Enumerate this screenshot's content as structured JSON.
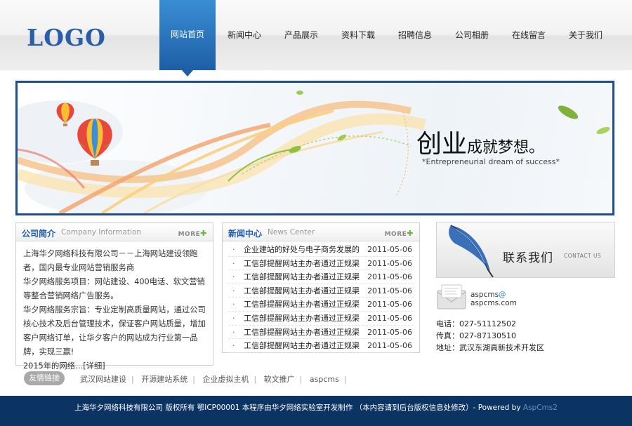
{
  "header": {
    "logo": "LOGO",
    "nav": [
      {
        "label": "网站首页",
        "active": true
      },
      {
        "label": "新闻中心"
      },
      {
        "label": "产品展示"
      },
      {
        "label": "资料下载"
      },
      {
        "label": "招聘信息"
      },
      {
        "label": "公司相册"
      },
      {
        "label": "在线留言"
      },
      {
        "label": "关于我们"
      }
    ]
  },
  "banner": {
    "headline_big": "创业",
    "headline_small": "成就梦想。",
    "subtitle": "*Entrepreneurial dream of success*"
  },
  "about": {
    "title": "公司简介",
    "title_en": "Company Information",
    "more": "MORE",
    "paragraphs": [
      "上海华夕网络科技有限公司－－上海网站建设领跑者，国内最专业网站营销服务商",
      "华夕网络服务项目：网站建设、400电话、软文营销等整合营销网络广告服务。",
      " 华夕网络服务宗旨：专业定制高质量网站，通过公司核心技术及后台管理技术，保证客户网站质量，增加客户网络订单，让华夕客户的网站成为行业第一品牌，实现三赢!",
      "2015年的网络…[详细]"
    ]
  },
  "news": {
    "title": "新闻中心",
    "title_en": "News Center",
    "more": "MORE",
    "items": [
      {
        "title": "企业建站的好处与电子商务发展的",
        "date": "2011-05-06"
      },
      {
        "title": "工信部提醒网站主办者通过正规渠",
        "date": "2011-05-06"
      },
      {
        "title": "工信部提醒网站主办者通过正规渠",
        "date": "2011-05-06"
      },
      {
        "title": "工信部提醒网站主办者通过正规渠",
        "date": "2011-05-06"
      },
      {
        "title": "工信部提醒网站主办者通过正规渠",
        "date": "2011-05-06"
      },
      {
        "title": "工信部提醒网站主办者通过正规渠",
        "date": "2011-05-06"
      },
      {
        "title": "工信部提醒网站主办者通过正规渠",
        "date": "2011-05-06"
      },
      {
        "title": "工信部提醒网站主办者通过正规渠",
        "date": "2011-05-06"
      }
    ]
  },
  "contact": {
    "title": "联系我们",
    "title_en": "CONTACT US",
    "email_line1": "aspcms",
    "email_at": "@",
    "email_line2": "aspcms.com",
    "phone": "电话：027-51112502",
    "fax": "传真：027-87130510",
    "address": "地址：武汉东湖高新技术开发区"
  },
  "links": {
    "label": "友情链接",
    "items": [
      "武汉网站建设",
      "开源建站系统",
      "企业虚拟主机",
      "软文推广",
      "aspcms"
    ]
  },
  "footer": {
    "text": "上海华夕网络科技有限公司  版权所有  鄂ICP00001 本程序由华夕网络实验室开发制作 （本内容请到后台版权信息处修改）- Powered by ",
    "brand": "AspCms2"
  },
  "colors": {
    "brand_blue": "#1e5aa8",
    "footer_bg": "#0b3462",
    "banner_border": "#1f4e8f"
  }
}
